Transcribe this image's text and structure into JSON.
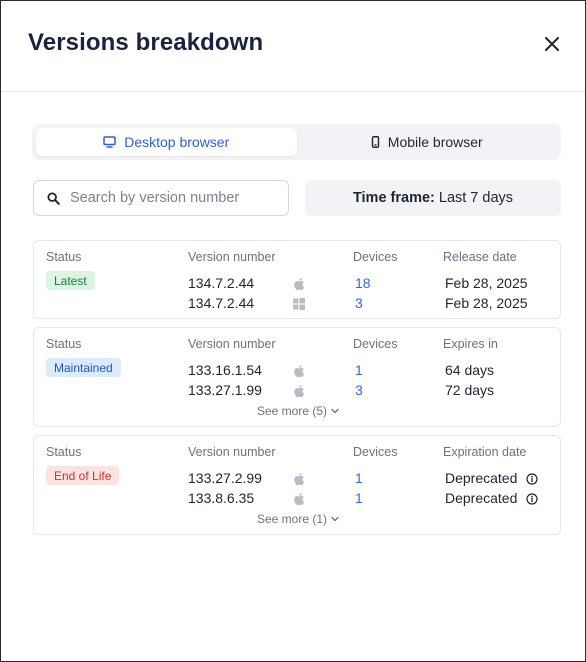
{
  "modal": {
    "title": "Versions breakdown"
  },
  "toggle": {
    "desktop_label": "Desktop browser",
    "mobile_label": "Mobile browser",
    "active": "desktop"
  },
  "search": {
    "placeholder": "Search by version number",
    "value": ""
  },
  "timeframe": {
    "label": "Time frame:",
    "value": "Last 7 days"
  },
  "cards": [
    {
      "status_header": "Status",
      "version_header": "Version number",
      "devices_header": "Devices",
      "date_header": "Release date",
      "status": "Latest",
      "rows": [
        {
          "version": "134.7.2.44",
          "os": "apple-icon",
          "devices": "18",
          "date": "Feb 28, 2025"
        },
        {
          "version": "134.7.2.44",
          "os": "windows-icon",
          "devices": "3",
          "date": "Feb 28, 2025"
        }
      ]
    },
    {
      "status_header": "Status",
      "version_header": "Version number",
      "devices_header": "Devices",
      "date_header": "Expires in",
      "status": "Maintained",
      "rows": [
        {
          "version": "133.16.1.54",
          "os": "apple-icon",
          "devices": "1",
          "date": "64 days"
        },
        {
          "version": "133.27.1.99",
          "os": "apple-icon",
          "devices": "3",
          "date": "72 days"
        }
      ],
      "see_more": "See more (5)"
    },
    {
      "status_header": "Status",
      "version_header": "Version number",
      "devices_header": "Devices",
      "date_header": "Expiration date",
      "status": "End of Life",
      "rows": [
        {
          "version": "133.27.2.99",
          "os": "apple-icon",
          "devices": "1",
          "date": "Deprecated"
        },
        {
          "version": "133.8.6.35",
          "os": "apple-icon",
          "devices": "1",
          "date": "Deprecated"
        }
      ],
      "see_more": "See more (1)"
    }
  ],
  "colors": {
    "accent": "#2f5fd0",
    "link": "#2f6bd8",
    "latest_bg": "#dcf5e3",
    "maintained_bg": "#dbeafc",
    "eol_bg": "#fde2e2"
  }
}
